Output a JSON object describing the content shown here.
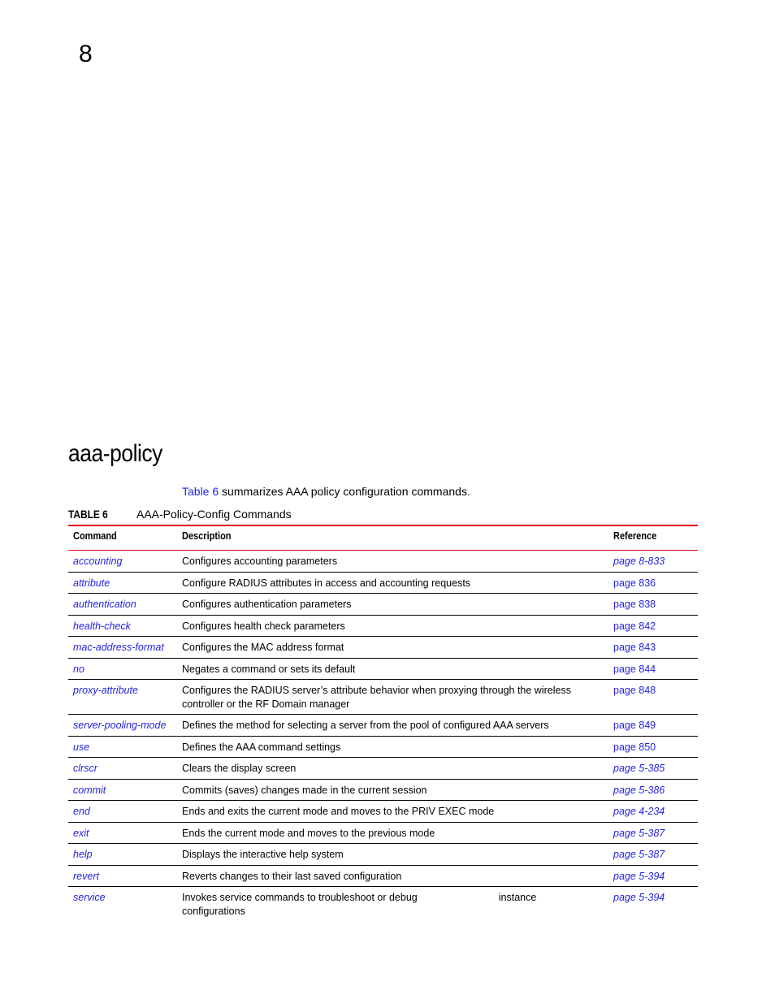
{
  "chapter": {
    "number": "8"
  },
  "section": {
    "title": "aaa-policy"
  },
  "intro": {
    "link_text": "Table 6",
    "text": " summarizes AAA policy configuration commands."
  },
  "table": {
    "caption_label": "TABLE 6",
    "caption_title": "AAA-Policy-Config Commands",
    "accent_color": "#e3001b",
    "link_color": "#2323e0",
    "headers": {
      "command": "Command",
      "description": "Description",
      "reference": "Reference"
    },
    "rows": [
      {
        "command": "accounting",
        "description": "Configures accounting parameters",
        "reference": "page 8-833",
        "ref_italic": true
      },
      {
        "command": "attribute",
        "description": "Configure RADIUS attributes in access and accounting requests",
        "reference": "page 836",
        "ref_italic": false
      },
      {
        "command": "authentication",
        "description": "Configures authentication parameters",
        "reference": "page 838",
        "ref_italic": false
      },
      {
        "command": "health-check",
        "description": "Configures health check parameters",
        "reference": "page 842",
        "ref_italic": false
      },
      {
        "command": "mac-address-format",
        "description": "Configures the MAC address format",
        "reference": "page 843",
        "ref_italic": false
      },
      {
        "command": "no",
        "description": "Negates a command or sets its default",
        "reference": "page 844",
        "ref_italic": false
      },
      {
        "command": "proxy-attribute",
        "description": "Configures the RADIUS server’s attribute behavior when proxying through the wireless controller or the RF Domain manager",
        "reference": "page 848",
        "ref_italic": false
      },
      {
        "command": "server-pooling-mode",
        "description": "Defines the method for selecting a server from the pool of configured AAA servers",
        "reference": "page 849",
        "ref_italic": false
      },
      {
        "command": "use",
        "description": "Defines the AAA command settings",
        "reference": "page 850",
        "ref_italic": false
      },
      {
        "command": "clrscr",
        "description": "Clears the display screen",
        "reference": "page 5-385",
        "ref_italic": true
      },
      {
        "command": "commit",
        "description": "Commits (saves) changes made in the current session",
        "reference": "page 5-386",
        "ref_italic": true
      },
      {
        "command": "end",
        "description": "Ends and exits the current mode and moves to the PRIV EXEC mode",
        "reference": "page 4-234",
        "ref_italic": true
      },
      {
        "command": "exit",
        "description": "Ends the current mode and moves to the previous mode",
        "reference": "page 5-387",
        "ref_italic": true
      },
      {
        "command": "help",
        "description": "Displays the interactive help system",
        "reference": "page 5-387",
        "ref_italic": true
      },
      {
        "command": "revert",
        "description": "Reverts changes to their last saved configuration",
        "reference": "page 5-394",
        "ref_italic": true
      },
      {
        "command": "service",
        "description": "Invokes service commands to troubleshoot or debug",
        "description_tail": "instance",
        "description_line2": "configurations",
        "reference": "page 5-394",
        "ref_italic": true
      }
    ]
  }
}
